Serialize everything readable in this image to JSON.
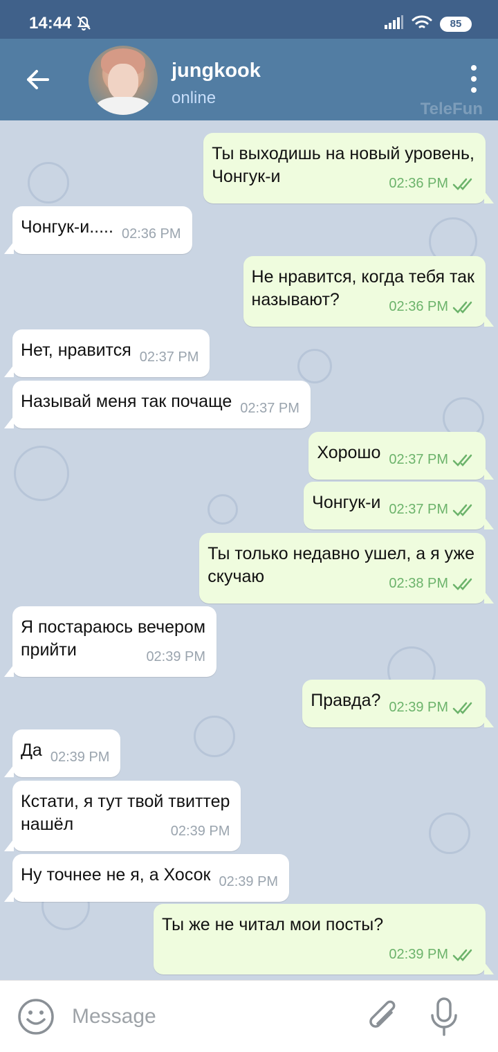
{
  "status_bar": {
    "time": "14:44",
    "battery": "85"
  },
  "header": {
    "contact_name": "jungkook",
    "contact_status": "online",
    "watermark": "TeleFun"
  },
  "messages": [
    {
      "dir": "out",
      "text": "Ты выходишь на новый уровень,\nЧонгук-и",
      "time": "02:36 PM"
    },
    {
      "dir": "in",
      "text": "Чонгук-и.....",
      "time": "02:36 PM"
    },
    {
      "dir": "out",
      "text": "Не нравится, когда тебя так\nназывают?",
      "time": "02:36 PM"
    },
    {
      "dir": "in",
      "text": "Нет, нравится",
      "time": "02:37 PM"
    },
    {
      "dir": "in",
      "text": "Называй меня так почаще",
      "time": "02:37 PM"
    },
    {
      "dir": "out",
      "text": "Хорошо",
      "time": "02:37 PM"
    },
    {
      "dir": "out",
      "text": "Чонгук-и",
      "time": "02:37 PM"
    },
    {
      "dir": "out",
      "text": "Ты только недавно ушел, а я уже\nскучаю",
      "time": "02:38 PM"
    },
    {
      "dir": "in",
      "text": "Я постараюсь вечером\nприйти",
      "time": "02:39 PM"
    },
    {
      "dir": "out",
      "text": "Правда?",
      "time": "02:39 PM"
    },
    {
      "dir": "in",
      "text": "Да",
      "time": "02:39 PM"
    },
    {
      "dir": "in",
      "text": "Кстати, я тут твой твиттер\nнашёл",
      "time": "02:39 PM"
    },
    {
      "dir": "in",
      "text": "Ну точнее не я, а Хосок",
      "time": "02:39 PM"
    },
    {
      "dir": "out",
      "text": "Ты же не читал мои посты?",
      "time": "02:39 PM"
    }
  ],
  "input": {
    "placeholder": "Message"
  },
  "colors": {
    "status_bar": "#40618a",
    "header": "#527da3",
    "chat_bg": "#cad5e3",
    "incoming_bubble": "#ffffff",
    "outgoing_bubble": "#effcde",
    "read_check": "#6cb36b"
  },
  "icons": {
    "back": "arrow-left-icon",
    "menu": "more-vertical-icon",
    "mute": "bell-off-icon",
    "signal": "signal-icon",
    "wifi": "wifi-icon",
    "battery": "battery-icon",
    "read": "double-check-icon",
    "emoji": "smile-icon",
    "attach": "paperclip-icon",
    "mic": "microphone-icon"
  }
}
